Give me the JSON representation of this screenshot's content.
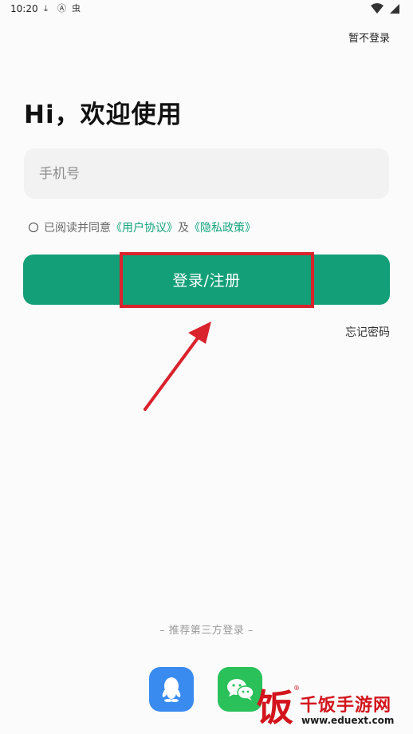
{
  "status_bar": {
    "time": "10:20",
    "icons": [
      "download-icon",
      "a-icon",
      "bug-icon",
      "wifi-icon",
      "battery-icon"
    ],
    "icon_glyphs": [
      "⤓",
      "Ⓐ",
      "虫"
    ]
  },
  "header": {
    "skip_label": "暂不登录"
  },
  "welcome": {
    "title": "Hi，欢迎使用"
  },
  "form": {
    "phone_placeholder": "手机号",
    "phone_value": ""
  },
  "agreement": {
    "prefix": "已阅读并同意",
    "user_agreement": "《用户协议》",
    "conjunction": "及",
    "privacy_policy": "《隐私政策》",
    "checked": false
  },
  "actions": {
    "login_label": "登录/注册",
    "forgot_label": "忘记密码"
  },
  "third_party": {
    "label": "– 推荐第三方登录 –",
    "providers": [
      "qq-icon",
      "wechat-icon"
    ]
  },
  "watermark": {
    "char": "饭",
    "reg": "®",
    "title": "千饭手游网",
    "url": "www.eduext.com"
  },
  "colors": {
    "brand": "#139f78",
    "link": "#11a47d",
    "annotation": "#d9232d",
    "qq": "#3a8bf0",
    "wechat": "#2ac05a"
  }
}
